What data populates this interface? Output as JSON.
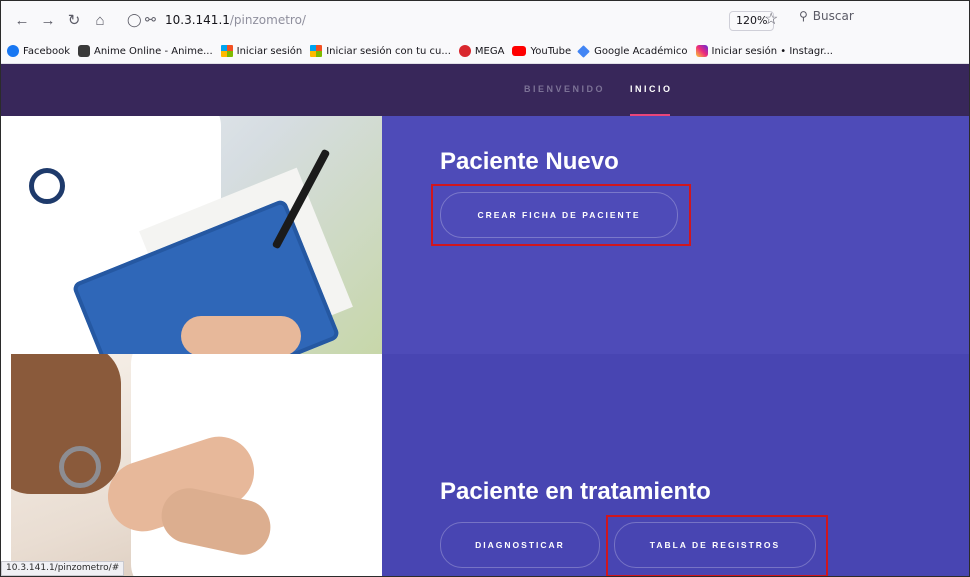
{
  "browser": {
    "url_host": "10.3.141.1",
    "url_path": "/pinzometro/",
    "zoom": "120%",
    "search_placeholder": "Buscar"
  },
  "bookmarks": [
    {
      "label": "Facebook",
      "icon": "facebook-icon"
    },
    {
      "label": "Anime Online - Anime...",
      "icon": "anime-online-icon"
    },
    {
      "label": "Iniciar sesión",
      "icon": "microsoft-icon"
    },
    {
      "label": "Iniciar sesión con tu cu...",
      "icon": "microsoft-icon"
    },
    {
      "label": "MEGA",
      "icon": "mega-icon"
    },
    {
      "label": "YouTube",
      "icon": "youtube-icon"
    },
    {
      "label": "Google Académico",
      "icon": "google-scholar-icon"
    },
    {
      "label": "Iniciar sesión • Instagr...",
      "icon": "instagram-icon"
    }
  ],
  "nav": {
    "bienvenido": "BIENVENIDO",
    "inicio": "INICIO"
  },
  "section_new": {
    "title": "Paciente Nuevo",
    "button": "CREAR FICHA DE PACIENTE"
  },
  "section_treatment": {
    "title": "Paciente en tratamiento",
    "button_diagnose": "DIAGNOSTICAR",
    "button_records": "TABLA DE REGISTROS"
  },
  "status_bar": "10.3.141.1/pinzometro/#",
  "colors": {
    "header": "#38275a",
    "panel": "#4e4bb8",
    "accent": "#e8457a",
    "highlight_box": "#d0161e"
  }
}
